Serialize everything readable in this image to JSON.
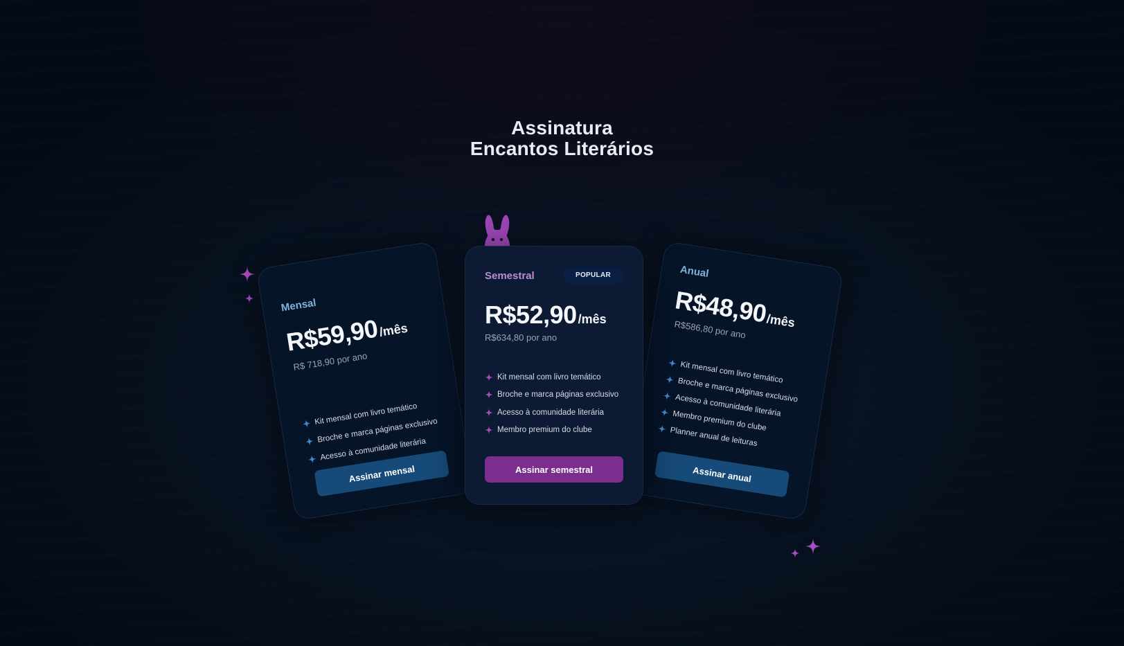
{
  "header": {
    "title_line1": "Assinatura",
    "title_line2": "Encantos Literários"
  },
  "colors": {
    "background": "#07101f",
    "accent_purple": "#7b2e8e",
    "accent_blue": "#164a78",
    "star_purple": "#a64cbf",
    "star_blue": "#3b8ad1"
  },
  "plans": [
    {
      "name": "Mensal",
      "price": "R$59,90",
      "period": "/mês",
      "yearly": "R$ 718,90 por ano",
      "features": [
        "Kit mensal com livro temático",
        "Broche e marca páginas exclusivo",
        "Acesso à comunidade literária"
      ],
      "cta": "Assinar mensal"
    },
    {
      "name": "Semestral",
      "badge": "POPULAR",
      "price": "R$52,90",
      "period": "/mês",
      "yearly": "R$634,80 por ano",
      "features": [
        "Kit mensal com livro temático",
        "Broche e marca páginas exclusivo",
        "Acesso à comunidade literária",
        "Membro premium do clube"
      ],
      "cta": "Assinar semestral"
    },
    {
      "name": "Anual",
      "price": "R$48,90",
      "period": "/mês",
      "yearly": "R$586,80 por ano",
      "features": [
        "Kit mensal com livro temático",
        "Broche e marca páginas exclusivo",
        "Acesso à comunidade literária",
        "Membro premium do clube",
        "Planner anual de leituras"
      ],
      "cta": "Assinar anual"
    }
  ],
  "icons": {
    "mascot": "bunny-icon",
    "feature_bullet": "sparkle-icon",
    "decoration": "sparkle-icon"
  }
}
